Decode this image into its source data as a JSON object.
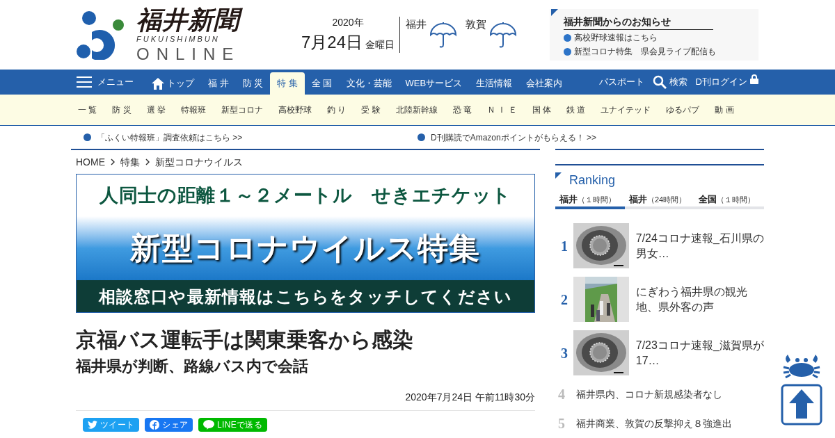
{
  "header": {
    "logo": {
      "name": "福井新聞",
      "romaji": "FUKUISHIMBUN",
      "online": "ONLINE"
    },
    "date": {
      "year": "2020年",
      "day": "7月24日",
      "weekday": "金曜日"
    },
    "weather": [
      {
        "city": "福井"
      },
      {
        "city": "敦賀"
      }
    ],
    "notices": {
      "title": "福井新聞からのお知らせ",
      "items": [
        "高校野球速報はこちら",
        "新型コロナ特集　県会見ライブ配信も"
      ]
    }
  },
  "nav": {
    "menu": "メニュー",
    "items": [
      {
        "label": "トップ",
        "kind": "home",
        "selected": false
      },
      {
        "label": "福 井",
        "kind": "text",
        "selected": false
      },
      {
        "label": "防 災",
        "kind": "text",
        "selected": false
      },
      {
        "label": "特 集",
        "kind": "text",
        "selected": true
      },
      {
        "label": "全 国",
        "kind": "text",
        "selected": false
      },
      {
        "label": "文化・芸能",
        "kind": "text",
        "selected": false
      },
      {
        "label": "WEBサービス",
        "kind": "text",
        "selected": false
      },
      {
        "label": "生活情報",
        "kind": "text",
        "selected": false
      },
      {
        "label": "会社案内",
        "kind": "text",
        "selected": false
      }
    ],
    "right": [
      {
        "label": "パスポート",
        "kind": "text"
      },
      {
        "label": "検索",
        "kind": "search"
      },
      {
        "label": "D刊ログイン",
        "kind": "lock"
      }
    ]
  },
  "subnav": [
    "一 覧",
    "防 災",
    "選 挙",
    "特報班",
    "新型コロナ",
    "高校野球",
    "釣 り",
    "受 験",
    "北陸新幹線",
    "恐 竜",
    "Ｎ Ｉ Ｅ",
    "国 体",
    "鉄 道",
    "ユナイテッド",
    "ゆるパブ",
    "動 画"
  ],
  "tickers": [
    "「ふくい特報班」調査依頼はこちら >>",
    "D刊購読でAmazonポイントがもらえる！ >>"
  ],
  "breadcrumb": [
    "HOME",
    "特集",
    "新型コロナウイルス"
  ],
  "banner": {
    "top": "人同士の距離１～２メートル　せきエチケット",
    "middle": "新型コロナウイルス特集",
    "bottom": "相談窓口や最新情報はこちらをタッチしてください"
  },
  "article": {
    "title": "京福バス運転手は関東乗客から感染",
    "subtitle": "福井県が判断、路線バス内で会話",
    "date": "2020年7月24日 午前11時30分",
    "share": [
      {
        "kind": "twitter",
        "label": "ツイート"
      },
      {
        "kind": "facebook",
        "label": "シェア"
      },
      {
        "kind": "line",
        "label": "LINEで送る"
      }
    ]
  },
  "ranking": {
    "title": "Ranking",
    "tabs": [
      {
        "label": "福井",
        "period": "（１時間）",
        "selected": true
      },
      {
        "label": "福井",
        "period": "（24時間）",
        "selected": false
      },
      {
        "label": "全国",
        "period": "（１時間）",
        "selected": false
      }
    ],
    "items": [
      {
        "rank": "1",
        "title": "7/24コロナ速報_石川県の男女…",
        "kind": "thumb"
      },
      {
        "rank": "2",
        "title": "にぎわう福井県の観光地、県外客の声",
        "kind": "thumb"
      },
      {
        "rank": "3",
        "title": "7/23コロナ速報_滋賀県が17…",
        "kind": "thumb"
      },
      {
        "rank": "4",
        "title": "福井県内、コロナ新規感染者なし",
        "kind": "text"
      },
      {
        "rank": "5",
        "title": "福井商業、敦賀の反撃抑え８強進出",
        "kind": "text"
      }
    ]
  }
}
